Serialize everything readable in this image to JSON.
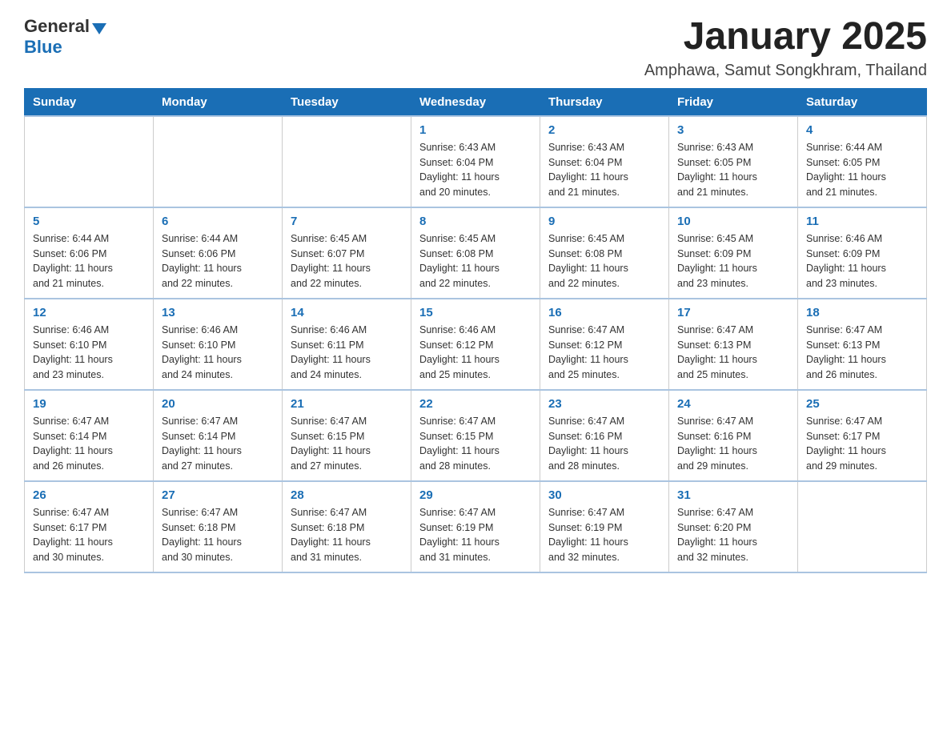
{
  "logo": {
    "general": "General",
    "blue": "Blue"
  },
  "title": "January 2025",
  "location": "Amphawa, Samut Songkhram, Thailand",
  "weekdays": [
    "Sunday",
    "Monday",
    "Tuesday",
    "Wednesday",
    "Thursday",
    "Friday",
    "Saturday"
  ],
  "weeks": [
    {
      "days": [
        {
          "number": "",
          "info": ""
        },
        {
          "number": "",
          "info": ""
        },
        {
          "number": "",
          "info": ""
        },
        {
          "number": "1",
          "info": "Sunrise: 6:43 AM\nSunset: 6:04 PM\nDaylight: 11 hours\nand 20 minutes."
        },
        {
          "number": "2",
          "info": "Sunrise: 6:43 AM\nSunset: 6:04 PM\nDaylight: 11 hours\nand 21 minutes."
        },
        {
          "number": "3",
          "info": "Sunrise: 6:43 AM\nSunset: 6:05 PM\nDaylight: 11 hours\nand 21 minutes."
        },
        {
          "number": "4",
          "info": "Sunrise: 6:44 AM\nSunset: 6:05 PM\nDaylight: 11 hours\nand 21 minutes."
        }
      ]
    },
    {
      "days": [
        {
          "number": "5",
          "info": "Sunrise: 6:44 AM\nSunset: 6:06 PM\nDaylight: 11 hours\nand 21 minutes."
        },
        {
          "number": "6",
          "info": "Sunrise: 6:44 AM\nSunset: 6:06 PM\nDaylight: 11 hours\nand 22 minutes."
        },
        {
          "number": "7",
          "info": "Sunrise: 6:45 AM\nSunset: 6:07 PM\nDaylight: 11 hours\nand 22 minutes."
        },
        {
          "number": "8",
          "info": "Sunrise: 6:45 AM\nSunset: 6:08 PM\nDaylight: 11 hours\nand 22 minutes."
        },
        {
          "number": "9",
          "info": "Sunrise: 6:45 AM\nSunset: 6:08 PM\nDaylight: 11 hours\nand 22 minutes."
        },
        {
          "number": "10",
          "info": "Sunrise: 6:45 AM\nSunset: 6:09 PM\nDaylight: 11 hours\nand 23 minutes."
        },
        {
          "number": "11",
          "info": "Sunrise: 6:46 AM\nSunset: 6:09 PM\nDaylight: 11 hours\nand 23 minutes."
        }
      ]
    },
    {
      "days": [
        {
          "number": "12",
          "info": "Sunrise: 6:46 AM\nSunset: 6:10 PM\nDaylight: 11 hours\nand 23 minutes."
        },
        {
          "number": "13",
          "info": "Sunrise: 6:46 AM\nSunset: 6:10 PM\nDaylight: 11 hours\nand 24 minutes."
        },
        {
          "number": "14",
          "info": "Sunrise: 6:46 AM\nSunset: 6:11 PM\nDaylight: 11 hours\nand 24 minutes."
        },
        {
          "number": "15",
          "info": "Sunrise: 6:46 AM\nSunset: 6:12 PM\nDaylight: 11 hours\nand 25 minutes."
        },
        {
          "number": "16",
          "info": "Sunrise: 6:47 AM\nSunset: 6:12 PM\nDaylight: 11 hours\nand 25 minutes."
        },
        {
          "number": "17",
          "info": "Sunrise: 6:47 AM\nSunset: 6:13 PM\nDaylight: 11 hours\nand 25 minutes."
        },
        {
          "number": "18",
          "info": "Sunrise: 6:47 AM\nSunset: 6:13 PM\nDaylight: 11 hours\nand 26 minutes."
        }
      ]
    },
    {
      "days": [
        {
          "number": "19",
          "info": "Sunrise: 6:47 AM\nSunset: 6:14 PM\nDaylight: 11 hours\nand 26 minutes."
        },
        {
          "number": "20",
          "info": "Sunrise: 6:47 AM\nSunset: 6:14 PM\nDaylight: 11 hours\nand 27 minutes."
        },
        {
          "number": "21",
          "info": "Sunrise: 6:47 AM\nSunset: 6:15 PM\nDaylight: 11 hours\nand 27 minutes."
        },
        {
          "number": "22",
          "info": "Sunrise: 6:47 AM\nSunset: 6:15 PM\nDaylight: 11 hours\nand 28 minutes."
        },
        {
          "number": "23",
          "info": "Sunrise: 6:47 AM\nSunset: 6:16 PM\nDaylight: 11 hours\nand 28 minutes."
        },
        {
          "number": "24",
          "info": "Sunrise: 6:47 AM\nSunset: 6:16 PM\nDaylight: 11 hours\nand 29 minutes."
        },
        {
          "number": "25",
          "info": "Sunrise: 6:47 AM\nSunset: 6:17 PM\nDaylight: 11 hours\nand 29 minutes."
        }
      ]
    },
    {
      "days": [
        {
          "number": "26",
          "info": "Sunrise: 6:47 AM\nSunset: 6:17 PM\nDaylight: 11 hours\nand 30 minutes."
        },
        {
          "number": "27",
          "info": "Sunrise: 6:47 AM\nSunset: 6:18 PM\nDaylight: 11 hours\nand 30 minutes."
        },
        {
          "number": "28",
          "info": "Sunrise: 6:47 AM\nSunset: 6:18 PM\nDaylight: 11 hours\nand 31 minutes."
        },
        {
          "number": "29",
          "info": "Sunrise: 6:47 AM\nSunset: 6:19 PM\nDaylight: 11 hours\nand 31 minutes."
        },
        {
          "number": "30",
          "info": "Sunrise: 6:47 AM\nSunset: 6:19 PM\nDaylight: 11 hours\nand 32 minutes."
        },
        {
          "number": "31",
          "info": "Sunrise: 6:47 AM\nSunset: 6:20 PM\nDaylight: 11 hours\nand 32 minutes."
        },
        {
          "number": "",
          "info": ""
        }
      ]
    }
  ]
}
